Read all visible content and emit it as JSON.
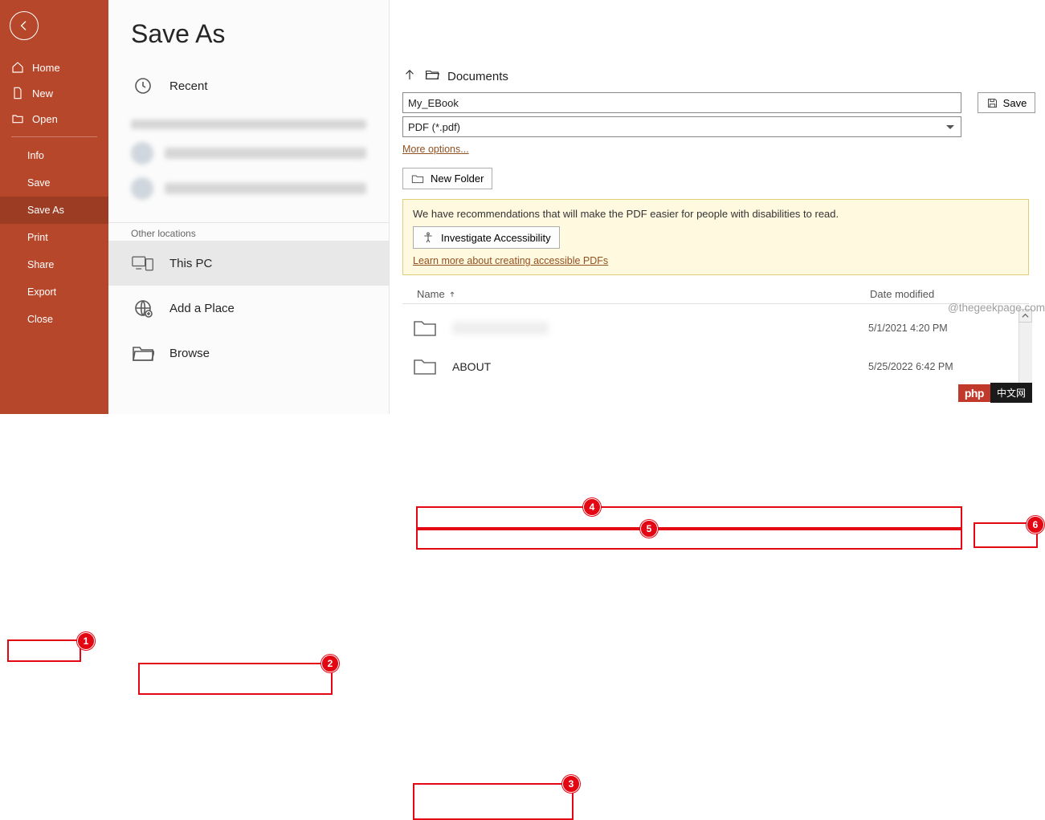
{
  "sidebar": {
    "home": "Home",
    "new": "New",
    "open": "Open",
    "info": "Info",
    "save": "Save",
    "save_as": "Save As",
    "print": "Print",
    "share": "Share",
    "export": "Export",
    "close": "Close"
  },
  "page_title": "Save As",
  "locations": {
    "recent": "Recent",
    "other_header": "Other locations",
    "this_pc": "This PC",
    "add_place": "Add a Place",
    "browse": "Browse"
  },
  "breadcrumb": {
    "folder": "Documents"
  },
  "filename": "My_EBook",
  "filetype": "PDF (*.pdf)",
  "save_label": "Save",
  "more_options": "More options...",
  "new_folder": "New Folder",
  "notice": {
    "text": "We have recommendations that will make the PDF easier for people with disabilities to read.",
    "button": "Investigate Accessibility",
    "link": "Learn more about creating accessible PDFs"
  },
  "columns": {
    "name": "Name",
    "date": "Date modified"
  },
  "rows": [
    {
      "name": "",
      "date": "5/1/2021 4:20 PM",
      "blurred": true
    },
    {
      "name": "ABOUT",
      "date": "5/25/2022 6:42 PM",
      "blurred": false
    }
  ],
  "watermark": "@thegeekpage.com",
  "annotations": [
    "1",
    "2",
    "3",
    "4",
    "5",
    "6"
  ],
  "php_badge": {
    "left": "php",
    "right": "中文网"
  }
}
